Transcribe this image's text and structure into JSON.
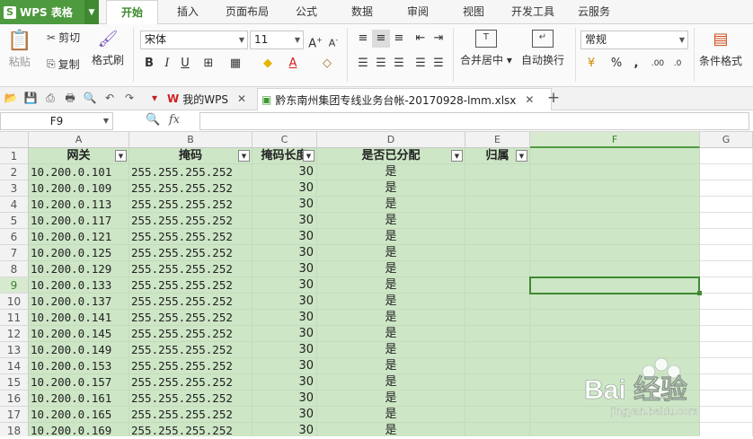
{
  "app": {
    "name": "WPS 表格",
    "logo_glyph": "S"
  },
  "menu_tabs": [
    "开始",
    "插入",
    "页面布局",
    "公式",
    "数据",
    "审阅",
    "视图",
    "开发工具",
    "云服务"
  ],
  "ribbon": {
    "paste": "粘贴",
    "cut": "剪切",
    "copy": "复制",
    "format_painter": "格式刷",
    "font_name": "宋体",
    "font_size": "11",
    "merge_center": "合并居中",
    "wrap_text": "自动换行",
    "number_format": "常规",
    "conditional_format": "条件格式"
  },
  "doc_tabs": [
    {
      "label": "我的WPS"
    },
    {
      "label": "黔东南州集团专线业务台帐-20170928-lmm.xlsx"
    }
  ],
  "formula_bar": {
    "name_box": "F9",
    "fx": "fx",
    "value": ""
  },
  "columns": [
    "A",
    "B",
    "C",
    "D",
    "E",
    "F",
    "G"
  ],
  "selected_column": "F",
  "selected_row": "9",
  "header_row": [
    "网关",
    "掩码",
    "掩码长度",
    "是否已分配",
    "归属"
  ],
  "rows": [
    {
      "n": "2",
      "gw": "10.200.0.101",
      "mask": "255.255.255.252",
      "len": "30",
      "alloc": "是"
    },
    {
      "n": "3",
      "gw": "10.200.0.109",
      "mask": "255.255.255.252",
      "len": "30",
      "alloc": "是"
    },
    {
      "n": "4",
      "gw": "10.200.0.113",
      "mask": "255.255.255.252",
      "len": "30",
      "alloc": "是"
    },
    {
      "n": "5",
      "gw": "10.200.0.117",
      "mask": "255.255.255.252",
      "len": "30",
      "alloc": "是"
    },
    {
      "n": "6",
      "gw": "10.200.0.121",
      "mask": "255.255.255.252",
      "len": "30",
      "alloc": "是"
    },
    {
      "n": "7",
      "gw": "10.200.0.125",
      "mask": "255.255.255.252",
      "len": "30",
      "alloc": "是"
    },
    {
      "n": "8",
      "gw": "10.200.0.129",
      "mask": "255.255.255.252",
      "len": "30",
      "alloc": "是"
    },
    {
      "n": "9",
      "gw": "10.200.0.133",
      "mask": "255.255.255.252",
      "len": "30",
      "alloc": "是"
    },
    {
      "n": "10",
      "gw": "10.200.0.137",
      "mask": "255.255.255.252",
      "len": "30",
      "alloc": "是"
    },
    {
      "n": "11",
      "gw": "10.200.0.141",
      "mask": "255.255.255.252",
      "len": "30",
      "alloc": "是"
    },
    {
      "n": "12",
      "gw": "10.200.0.145",
      "mask": "255.255.255.252",
      "len": "30",
      "alloc": "是"
    },
    {
      "n": "13",
      "gw": "10.200.0.149",
      "mask": "255.255.255.252",
      "len": "30",
      "alloc": "是"
    },
    {
      "n": "14",
      "gw": "10.200.0.153",
      "mask": "255.255.255.252",
      "len": "30",
      "alloc": "是"
    },
    {
      "n": "15",
      "gw": "10.200.0.157",
      "mask": "255.255.255.252",
      "len": "30",
      "alloc": "是"
    },
    {
      "n": "16",
      "gw": "10.200.0.161",
      "mask": "255.255.255.252",
      "len": "30",
      "alloc": "是"
    },
    {
      "n": "17",
      "gw": "10.200.0.165",
      "mask": "255.255.255.252",
      "len": "30",
      "alloc": "是"
    },
    {
      "n": "18",
      "gw": "10.200.0.169",
      "mask": "255.255.255.252",
      "len": "30",
      "alloc": "是"
    }
  ],
  "watermark": {
    "brand": "Bai 经验",
    "url": "jingyan.baidu.com"
  },
  "colors": {
    "accent": "#4e9a3f",
    "selection_fill": "#cde6c6"
  }
}
